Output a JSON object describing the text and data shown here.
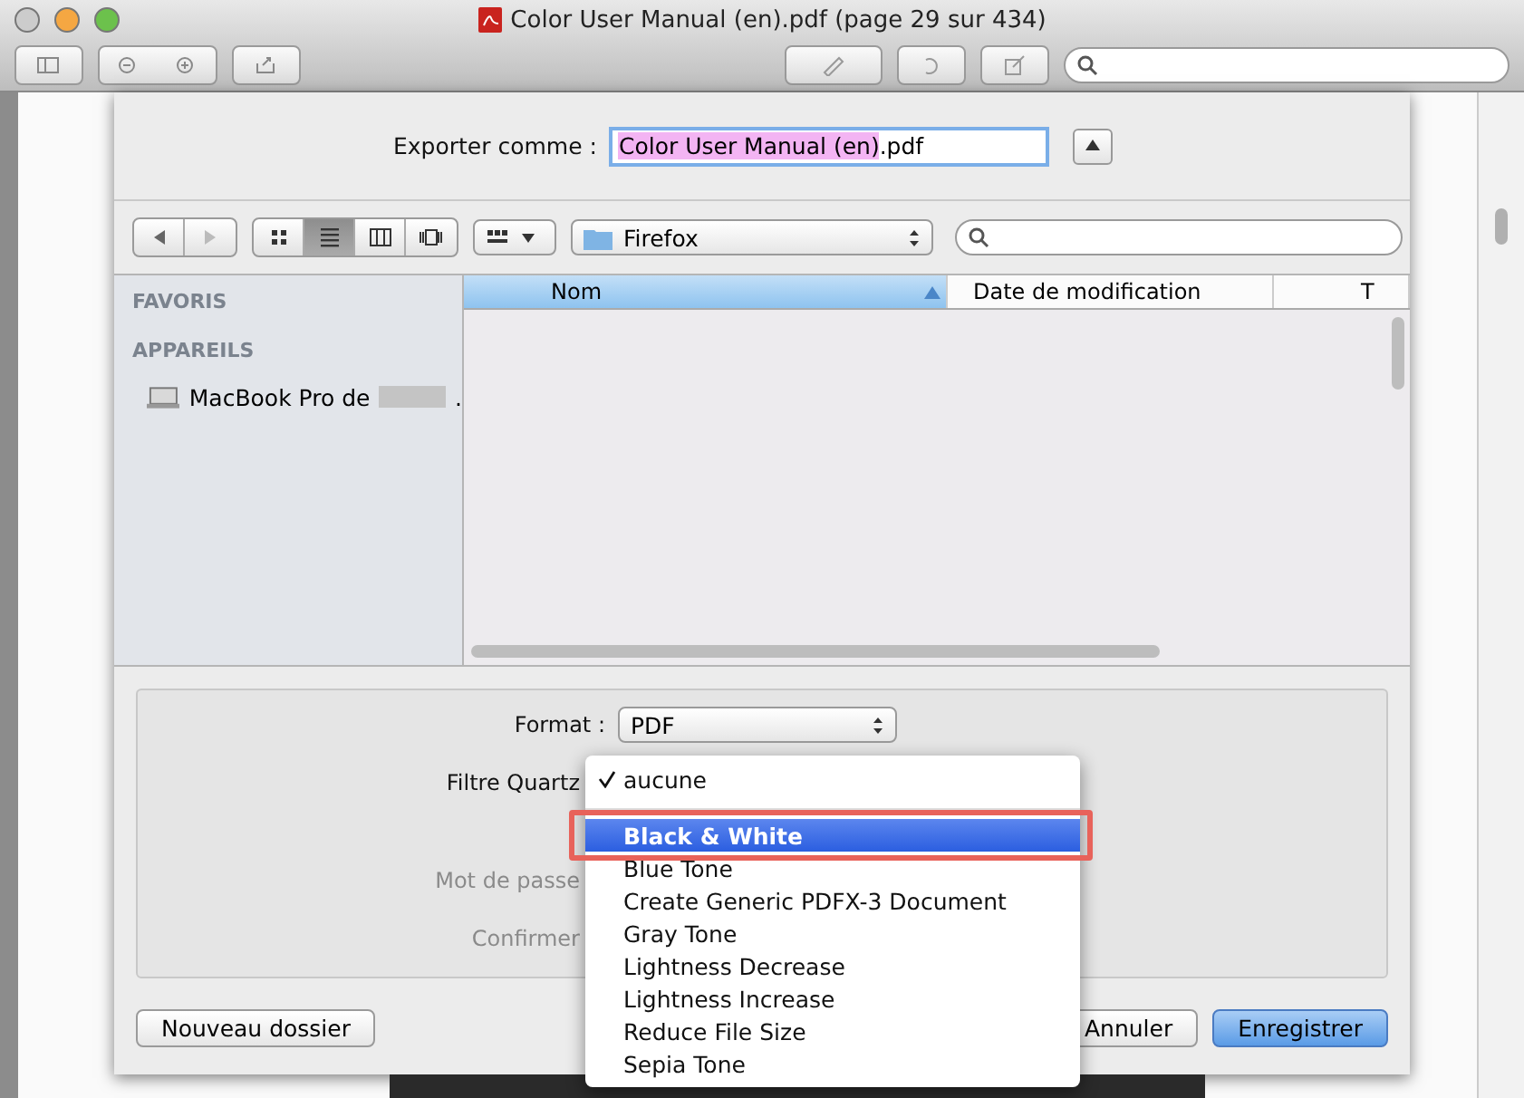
{
  "window": {
    "title": "Color User Manual (en).pdf (page 29 sur 434)"
  },
  "save_sheet": {
    "export_label": "Exporter comme :",
    "filename": {
      "selected_text": "Color User Manual (en)",
      "rest": ".pdf"
    },
    "expanded": true
  },
  "browser": {
    "view_modes": [
      {
        "kind": "icons",
        "selected": false
      },
      {
        "kind": "list",
        "selected": true
      },
      {
        "kind": "columns",
        "selected": false
      },
      {
        "kind": "coverflow",
        "selected": false
      }
    ],
    "location": "Firefox",
    "sidebar": [
      {
        "heading": "FAVORIS"
      },
      {
        "heading": "APPAREILS",
        "items": [
          {
            "label": "MacBook Pro de",
            "suffix": "."
          }
        ]
      }
    ],
    "columns": [
      {
        "label": "Nom",
        "sorted": true
      },
      {
        "label": "Date de modification",
        "sorted": false
      },
      {
        "label": "T",
        "sorted": false
      }
    ]
  },
  "options": {
    "format_label": "Format :",
    "format_value": "PDF",
    "quartz_label": "Filtre Quartz",
    "password_label": "Mot de passe",
    "confirm_label": "Confirmer"
  },
  "buttons": [
    {
      "label": "Nouveau dossier",
      "default": false
    },
    {
      "label": "Annuler",
      "default": false
    },
    {
      "label": "Enregistrer",
      "default": true
    }
  ],
  "quartz_menu": [
    {
      "kind": "item",
      "label": "aucune",
      "checked": true,
      "selected": false
    },
    {
      "kind": "separator"
    },
    {
      "kind": "item",
      "label": "Black & White",
      "checked": false,
      "selected": true,
      "annotated": true
    },
    {
      "kind": "item",
      "label": "Blue Tone",
      "checked": false,
      "selected": false
    },
    {
      "kind": "item",
      "label": "Create Generic PDFX-3 Document",
      "checked": false,
      "selected": false
    },
    {
      "kind": "item",
      "label": "Gray Tone",
      "checked": false,
      "selected": false
    },
    {
      "kind": "item",
      "label": "Lightness Decrease",
      "checked": false,
      "selected": false
    },
    {
      "kind": "item",
      "label": "Lightness Increase",
      "checked": false,
      "selected": false
    },
    {
      "kind": "item",
      "label": "Reduce File Size",
      "checked": false,
      "selected": false
    },
    {
      "kind": "item",
      "label": "Sepia Tone",
      "checked": false,
      "selected": false
    }
  ]
}
